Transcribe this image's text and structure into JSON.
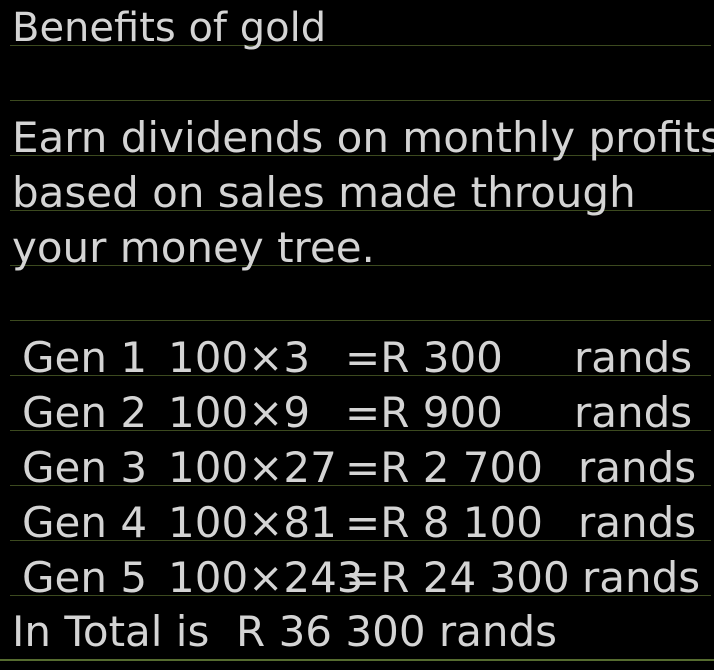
{
  "note": {
    "title": "Benefits of gold",
    "paragraph": [
      "Earn dividends on monthly profits",
      "based on sales made through",
      "your money tree."
    ],
    "rows": [
      {
        "gen": "Gen 1",
        "calc": "100×3",
        "amount": "=R 300",
        "unit": "rands"
      },
      {
        "gen": "Gen 2",
        "calc": "100×9",
        "amount": "=R 900",
        "unit": "rands"
      },
      {
        "gen": "Gen 3",
        "calc": "100×27",
        "amount": "=R 2 700",
        "unit": "rands"
      },
      {
        "gen": "Gen 4",
        "calc": "100×81",
        "amount": "=R 8 100",
        "unit": "rands"
      },
      {
        "gen": "Gen 5",
        "calc": "100×243",
        "amount": "=R 24 300",
        "unit": "rands"
      }
    ],
    "total": "In Total is  R 36 300 rands"
  },
  "colors": {
    "background": "#000000",
    "text": "#d4d4d4",
    "rule": "#3c4a1f"
  }
}
